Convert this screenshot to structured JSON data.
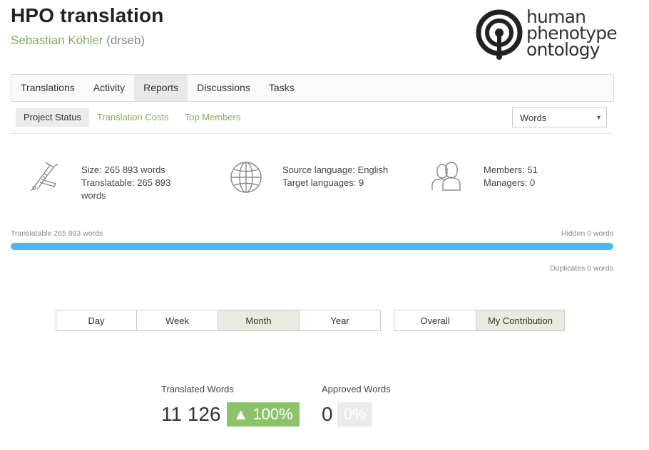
{
  "header": {
    "title": "HPO translation",
    "owner_name": "Sebastian Köhler",
    "owner_handle": "(drseb)",
    "logo_lines": [
      "human",
      "phenotype",
      "ontology"
    ]
  },
  "tabs": [
    "Translations",
    "Activity",
    "Reports",
    "Discussions",
    "Tasks"
  ],
  "active_tab": "Reports",
  "subtabs": [
    "Project Status",
    "Translation Costs",
    "Top Members"
  ],
  "active_subtab": "Project Status",
  "unit_select": {
    "value": "Words"
  },
  "stats": {
    "size": {
      "icon": "caliper-icon",
      "line1": "Size: 265 893 words",
      "line2": "Translatable: 265 893",
      "line3": "words"
    },
    "languages": {
      "icon": "globe-icon",
      "line1": "Source language: English",
      "line2": "Target languages: 9"
    },
    "members": {
      "icon": "members-icon",
      "line1": "Members: 51",
      "line2": "Managers: 0"
    }
  },
  "progress": {
    "translatable_label": "Translatable 265 893 words",
    "hidden_label": "Hidden 0 words",
    "duplicates_label": "Duplicates 0 words",
    "translatable_fraction": 1.0,
    "bar_color": "#4cb8f0"
  },
  "period_buttons": [
    "Day",
    "Week",
    "Month",
    "Year"
  ],
  "active_period": "Month",
  "scope_buttons": [
    "Overall",
    "My Contribution"
  ],
  "active_scope": "My Contribution",
  "translated": {
    "label": "Translated Words",
    "value": "11 126",
    "badge": "▲ 100%",
    "badge_color": "#8cc26b"
  },
  "approved": {
    "label": "Approved Words",
    "value": "0",
    "badge": "0%",
    "badge_color": "#ebebeb"
  }
}
